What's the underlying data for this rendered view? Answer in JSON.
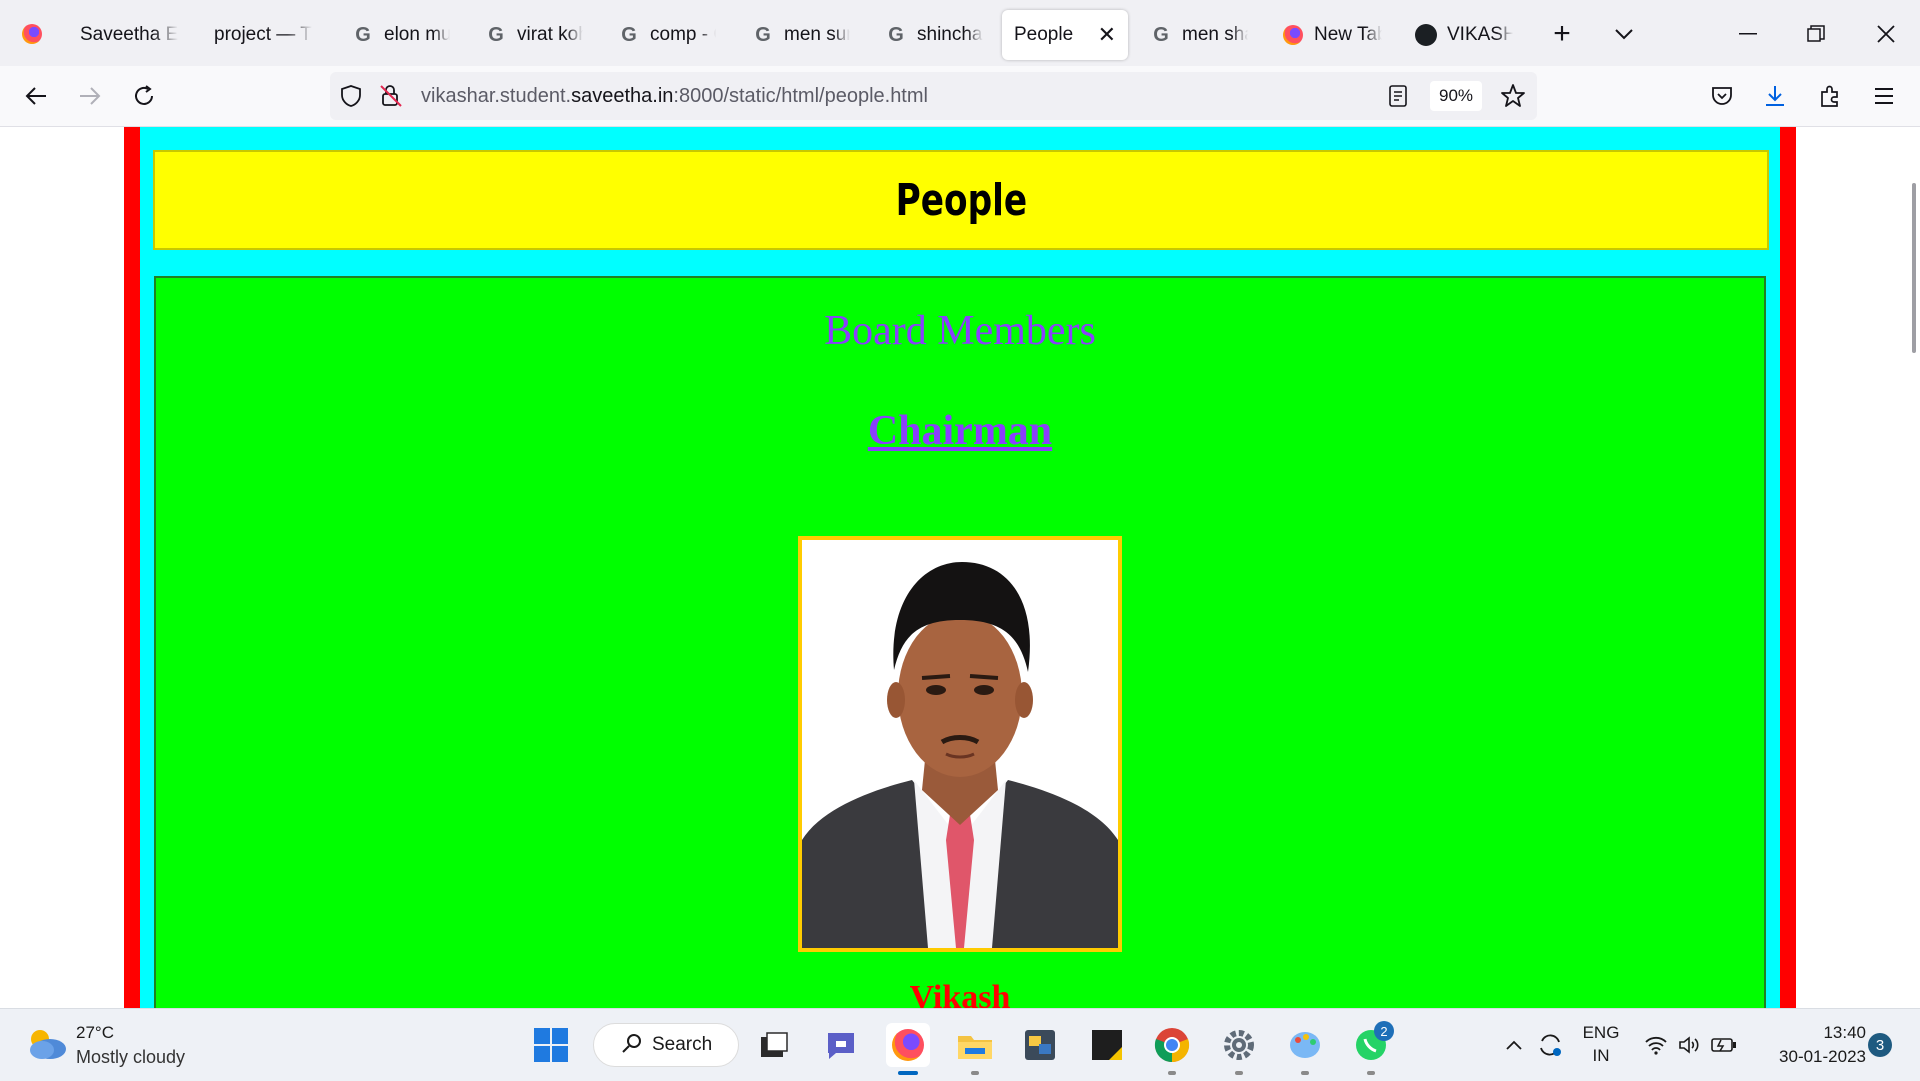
{
  "browser": {
    "tabs": [
      {
        "label": "Saveetha Eng",
        "icon": "saveetha-icon",
        "active": false
      },
      {
        "label": "project — Th",
        "icon": "none",
        "active": false
      },
      {
        "label": "elon mus",
        "icon": "google-icon",
        "active": false
      },
      {
        "label": "virat koh",
        "icon": "google-icon",
        "active": false
      },
      {
        "label": "comp - C",
        "icon": "google-icon",
        "active": false
      },
      {
        "label": "men sun",
        "icon": "google-icon",
        "active": false
      },
      {
        "label": "shinchan",
        "icon": "google-icon",
        "active": false
      },
      {
        "label": "People",
        "icon": "none",
        "active": true
      },
      {
        "label": "men sha",
        "icon": "google-icon",
        "active": false
      },
      {
        "label": "New Tab",
        "icon": "firefox-icon",
        "active": false
      },
      {
        "label": "VIKASHA",
        "icon": "github-icon",
        "active": false
      }
    ],
    "url_prefix": "vikashar.student.",
    "url_domain": "saveetha.in",
    "url_suffix": ":8000/static/html/people.html",
    "zoom": "90%"
  },
  "page": {
    "heading": "People",
    "section_title": "Board Members",
    "role_link": "Chairman",
    "member_name": "Vikash"
  },
  "colors": {
    "outer_frame": "#ff0000",
    "inner_frame": "#00ffff",
    "header_bg": "#ffff00",
    "content_bg": "#00ff00",
    "title_text": "#8a3ffc",
    "name_text": "#ff0000"
  },
  "taskbar": {
    "weather_temp": "27°C",
    "weather_desc": "Mostly cloudy",
    "search_label": "Search",
    "whatsapp_badge": "2",
    "lang_top": "ENG",
    "lang_bottom": "IN",
    "time": "13:40",
    "date": "30-01-2023",
    "notification_count": "3"
  }
}
